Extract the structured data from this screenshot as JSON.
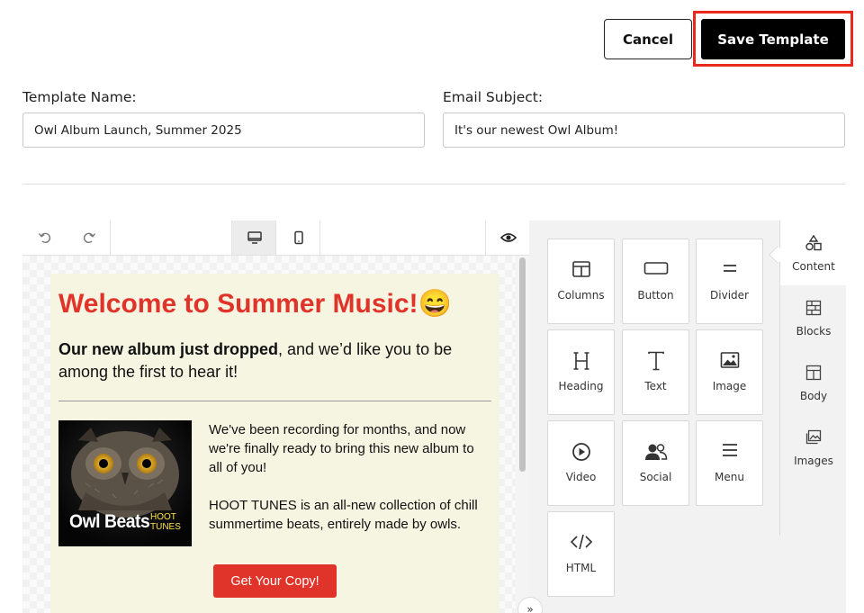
{
  "header": {
    "cancel_label": "Cancel",
    "save_label": "Save Template"
  },
  "form": {
    "template_name_label": "Template Name:",
    "template_name_value": "Owl Album Launch, Summer 2025",
    "email_subject_label": "Email Subject:",
    "email_subject_value": "It's our newest Owl Album!"
  },
  "toolbar": {
    "icons": [
      "undo-icon",
      "redo-icon",
      "desktop-preview-icon",
      "mobile-preview-icon",
      "eye-preview-icon"
    ],
    "active_view": "desktop"
  },
  "email": {
    "heading": "Welcome to Summer Music!😄",
    "intro_bold": "Our new album just dropped",
    "intro_rest": ", and we’d like you to be among the first to hear it!",
    "paragraph_1": "We've been recording for months, and now we're finally ready to bring this new album to all of you!",
    "paragraph_2": "HOOT TUNES is an all-new collection of chill summertime beats, entirely made by owls.",
    "album_title": "Owl Beats",
    "album_brand_line1": "HOOT",
    "album_brand_line2": "TUNES",
    "cta_label": "Get Your Copy!",
    "colors": {
      "background": "#f6f5e1",
      "accent": "#e0342a"
    }
  },
  "content_tiles": [
    {
      "label": "Columns",
      "icon": "columns-icon"
    },
    {
      "label": "Button",
      "icon": "button-icon"
    },
    {
      "label": "Divider",
      "icon": "divider-icon"
    },
    {
      "label": "Heading",
      "icon": "heading-icon"
    },
    {
      "label": "Text",
      "icon": "text-icon"
    },
    {
      "label": "Image",
      "icon": "image-icon"
    },
    {
      "label": "Video",
      "icon": "video-icon"
    },
    {
      "label": "Social",
      "icon": "social-icon"
    },
    {
      "label": "Menu",
      "icon": "menu-icon"
    },
    {
      "label": "HTML",
      "icon": "html-icon"
    }
  ],
  "side_tabs": [
    {
      "label": "Content",
      "icon": "shapes-icon",
      "active": true
    },
    {
      "label": "Blocks",
      "icon": "blocks-icon",
      "active": false
    },
    {
      "label": "Body",
      "icon": "body-layout-icon",
      "active": false
    },
    {
      "label": "Images",
      "icon": "images-icon",
      "active": false
    }
  ]
}
